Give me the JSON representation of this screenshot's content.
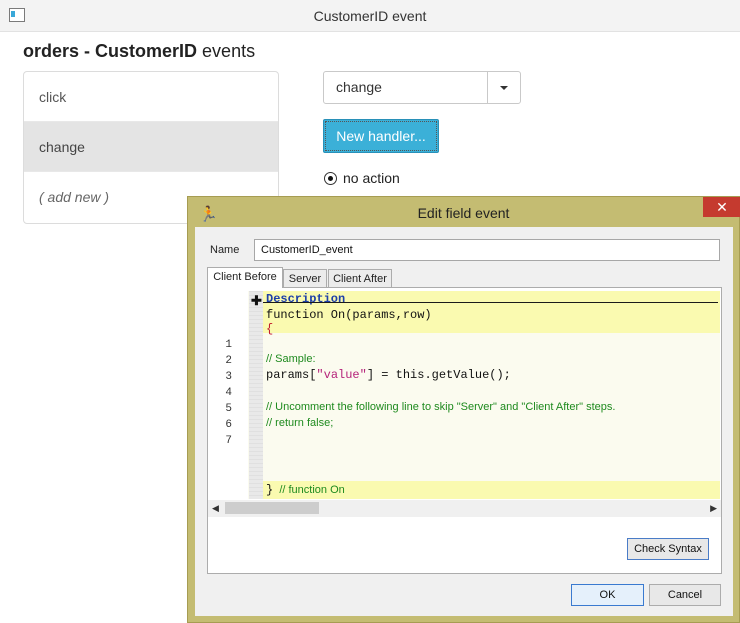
{
  "window": {
    "title": "CustomerID event"
  },
  "page": {
    "heading_bold": "orders - CustomerID",
    "heading_rest": " events"
  },
  "events": [
    {
      "label": "click"
    },
    {
      "label": "change"
    },
    {
      "label": "( add new )"
    }
  ],
  "selected_event": "change",
  "new_handler_label": "New handler...",
  "radio_label": "no action",
  "dialog": {
    "title": "Edit field event",
    "close_glyph": "✕",
    "name_label": "Name",
    "name_value": "CustomerID_event",
    "tabs": [
      "Client Before",
      "Server",
      "Client After"
    ],
    "active_tab": "Client Before",
    "code": {
      "description": "Description",
      "function_header": "function On(params,row)",
      "open_brace": "{",
      "line_numbers": [
        "1",
        "2",
        "3",
        "4",
        "5",
        "6",
        "7"
      ],
      "comment_sample": "// Sample:",
      "params_prefix": "params",
      "params_bracket_open": "[",
      "params_key": "\"value\"",
      "params_bracket_close": "]",
      "params_rest": " = this.getValue",
      "params_call": "();",
      "comment_uncomment": "// Uncomment the following line to skip \"Server\" and \"Client After\" steps.",
      "comment_return": "// return false;",
      "close_brace": "}",
      "close_comment": "  // function On"
    },
    "check_syntax_label": "Check Syntax",
    "ok_label": "OK",
    "cancel_label": "Cancel"
  }
}
